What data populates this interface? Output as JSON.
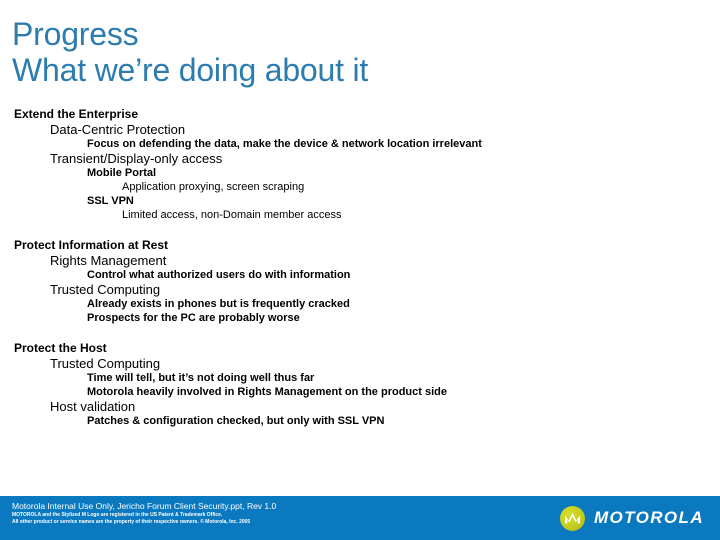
{
  "slide": {
    "title": {
      "line1": "Progress",
      "line2": "What we’re doing about it",
      "color": "#2C7CB0"
    },
    "groups": [
      {
        "heading": "Extend the Enterprise",
        "items": [
          {
            "level": 2,
            "text": "Data-Centric Protection"
          },
          {
            "level": 3,
            "text": "Focus on defending the data, make the device & network location irrelevant"
          },
          {
            "level": 2,
            "text": "Transient/Display-only access"
          },
          {
            "level": 3,
            "text": "Mobile Portal"
          },
          {
            "level": 4,
            "text": "Application proxying, screen scraping"
          },
          {
            "level": 3,
            "text": "SSL VPN"
          },
          {
            "level": 4,
            "text": "Limited access, non-Domain member access"
          }
        ]
      },
      {
        "heading": "Protect Information at Rest",
        "items": [
          {
            "level": 2,
            "text": "Rights Management"
          },
          {
            "level": 3,
            "text": "Control what authorized users do with information"
          },
          {
            "level": 2,
            "text": "Trusted Computing"
          },
          {
            "level": 3,
            "text": "Already exists in phones but is frequently cracked"
          },
          {
            "level": 3,
            "text": "Prospects for the PC are probably worse"
          }
        ]
      },
      {
        "heading": "Protect the Host",
        "items": [
          {
            "level": 2,
            "text": "Trusted Computing"
          },
          {
            "level": 3,
            "text": "Time will tell, but it’s not doing well thus far"
          },
          {
            "level": 3,
            "text": "Motorola heavily involved in Rights Management on the product side"
          },
          {
            "level": 2,
            "text": "Host validation"
          },
          {
            "level": 3,
            "text": "Patches & configuration checked, but only with SSL VPN"
          }
        ]
      }
    ],
    "footer": {
      "bar_color": "#0B79C0",
      "line1": "Motorola Internal Use Only, Jericho Forum Client Security.ppt, Rev 1.0",
      "line2": "MOTOROLA and the Stylized M Logo are registered in the US Patent & Trademark Office.",
      "line3": "All other product or service names are the property of their respective owners. © Motorola, Inc. 2005",
      "logo": {
        "mark_icon": "motorola-m-batwing-icon",
        "mark_color": "#C7CF20",
        "wordmark": "MOTOROLA"
      }
    }
  }
}
